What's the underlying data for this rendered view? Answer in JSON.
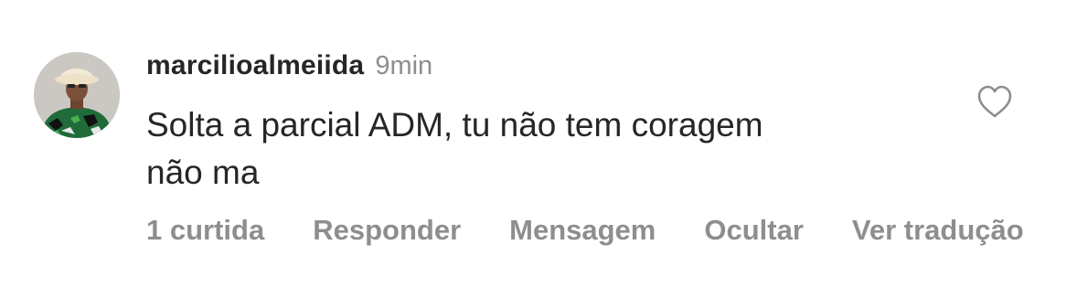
{
  "comment": {
    "username": "marcilioalmeiida",
    "time": "9min",
    "text": "Solta a parcial ADM, tu não tem coragem\nnão ma",
    "avatar_icon": "user-avatar-photo",
    "like_icon": "heart-outline-icon"
  },
  "actions": {
    "likes": "1 curtida",
    "reply": "Responder",
    "message": "Mensagem",
    "hide": "Ocultar",
    "translate": "Ver tradução"
  },
  "colors": {
    "primary_text": "#262626",
    "secondary_text": "#8e8e8e",
    "background": "#ffffff"
  }
}
